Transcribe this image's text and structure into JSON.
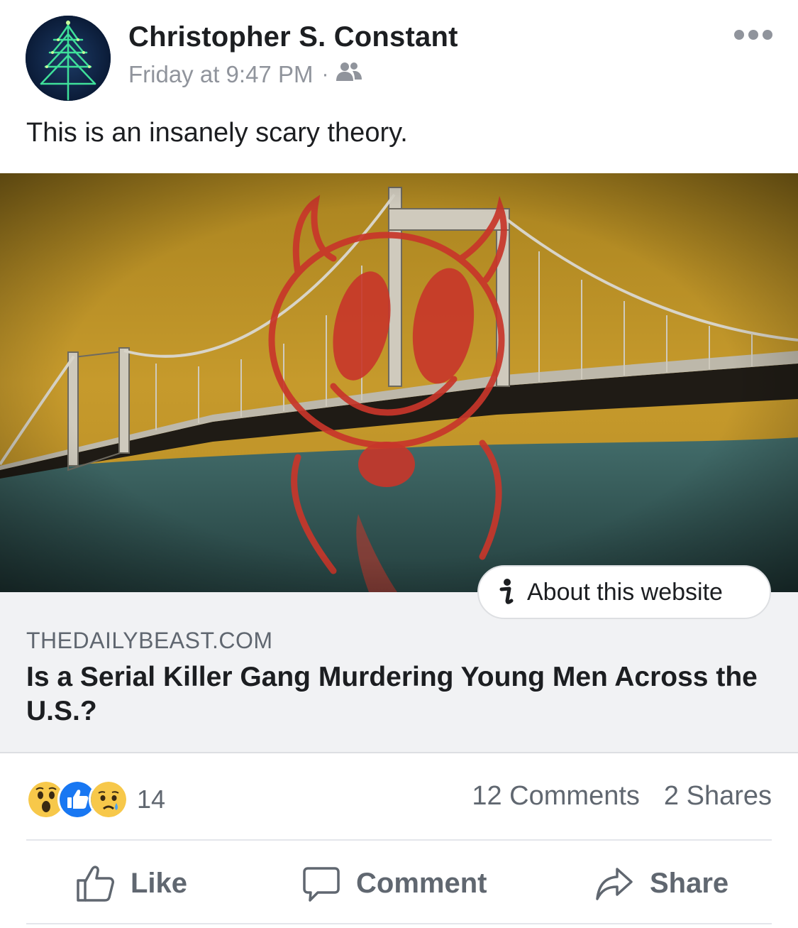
{
  "post": {
    "author": "Christopher S. Constant",
    "timestamp": "Friday at 9:47 PM",
    "separator": "·",
    "audience_icon": "friends-icon",
    "text": "This is an insanely scary theory."
  },
  "link": {
    "about_label": "About this website",
    "domain": "THEDAILYBEAST.COM",
    "headline": "Is a Serial Killer Gang Murdering Young Men Across the U.S.?"
  },
  "engagement": {
    "reaction_icons": [
      "wow-reaction-icon",
      "like-reaction-icon",
      "sad-reaction-icon"
    ],
    "reaction_count": "14",
    "comments": "12 Comments",
    "shares": "2 Shares"
  },
  "actions": {
    "like": "Like",
    "comment": "Comment",
    "share": "Share"
  },
  "colors": {
    "like_blue": "#1877f2",
    "meta_gray": "#90949c",
    "link_bg": "#f1f2f4"
  }
}
